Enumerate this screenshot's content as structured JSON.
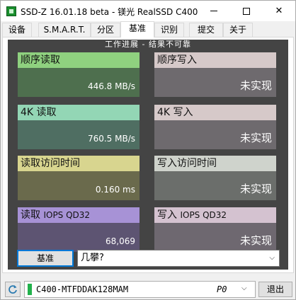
{
  "window": {
    "title": "SSD-Z 16.01.18 beta - 镁光 RealSSD C400"
  },
  "tabs": [
    {
      "label": "设备",
      "active": false
    },
    {
      "label": "S.M.A.R.T.",
      "active": false
    },
    {
      "label": "分区",
      "active": false
    },
    {
      "label": "基准",
      "active": true
    },
    {
      "label": "识别",
      "active": false
    },
    {
      "label": "提交",
      "active": false
    },
    {
      "label": "关于",
      "active": false
    }
  ],
  "bench": {
    "header": "工作进展 - 结果不可靠",
    "cards": [
      {
        "label": "顺序读取",
        "value": "446.8 MB/s",
        "head_color": "#8fd17f",
        "body_color": "#4e6f4e"
      },
      {
        "label": "顺序写入",
        "value": "未实现",
        "head_color": "#d6c9c9",
        "body_color": "#6e6a6e"
      },
      {
        "label": "4K 读取",
        "value": "760.5 MB/s",
        "head_color": "#93d6b5",
        "body_color": "#4f6e62"
      },
      {
        "label": "4K 写入",
        "value": "未实现",
        "head_color": "#d6c9c9",
        "body_color": "#6e6a6e"
      },
      {
        "label": "读取访问时间",
        "value": "0.160 ms",
        "head_color": "#d8d58f",
        "body_color": "#6a6a4c"
      },
      {
        "label": "写入访问时间",
        "value": "未实现",
        "head_color": "#cfd3cc",
        "body_color": "#6b6e6b"
      },
      {
        "label": "读取",
        "label_suffix": "IOPS QD32",
        "value": "68,069",
        "head_color": "#a792d6",
        "body_color": "#5d5472"
      },
      {
        "label": "写入",
        "label_suffix": "IOPS QD32",
        "value": "未实现",
        "head_color": "#d4c2d0",
        "body_color": "#6e6870"
      }
    ],
    "button_label": "基准",
    "select_value": "几攀?"
  },
  "status": {
    "drive_name": "C400-MTFDDAK128MAM",
    "drive_port": "P0",
    "exit_label": "退出"
  },
  "icons": {
    "app": "ssd-z-app-icon",
    "refresh": "refresh-icon",
    "dropdown": "chevron-down-icon"
  }
}
